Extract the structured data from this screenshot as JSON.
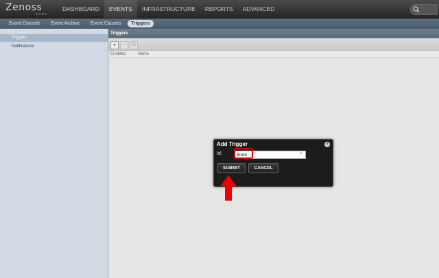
{
  "logo": {
    "main": "Zenoss",
    "sub": "CORE"
  },
  "nav": {
    "items": [
      {
        "label": "DASHBOARD"
      },
      {
        "label": "EVENTS"
      },
      {
        "label": "INFRASTRUCTURE"
      },
      {
        "label": "REPORTS"
      },
      {
        "label": "ADVANCED"
      }
    ],
    "active": "EVENTS"
  },
  "subnav": {
    "items": [
      {
        "label": "Event Console"
      },
      {
        "label": "Event Archive"
      },
      {
        "label": "Event Classes"
      },
      {
        "label": "Triggers"
      }
    ],
    "active": "Triggers"
  },
  "sidebar": {
    "items": [
      {
        "label": "Triggers"
      },
      {
        "label": "Notifications"
      }
    ],
    "selected": "Triggers"
  },
  "panel": {
    "title": "Triggers",
    "toolbar": {
      "add": "+",
      "remove": "−",
      "settings": "⚙"
    },
    "columns": [
      "Enabled",
      "Name"
    ]
  },
  "dialog": {
    "title": "Add Trigger",
    "close": "×",
    "id_label": "Id:",
    "id_value": "Error",
    "clear": "×",
    "submit": "SUBMIT",
    "cancel": "CANCEL"
  },
  "colors": {
    "highlight": "#e00000",
    "arrow": "#f00000"
  }
}
